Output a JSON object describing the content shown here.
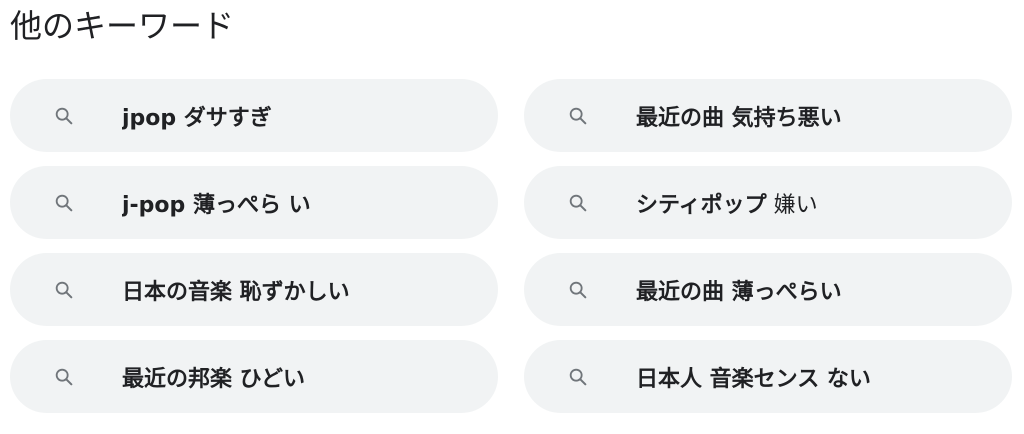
{
  "section": {
    "title": "他のキーワード"
  },
  "keywords": [
    {
      "bold": "jpop ダサすぎ",
      "plain": ""
    },
    {
      "bold": "最近の曲 気持ち悪い",
      "plain": ""
    },
    {
      "bold": "j-pop 薄っぺら い",
      "plain": ""
    },
    {
      "bold": "シティポップ",
      "plain": " 嫌い"
    },
    {
      "bold": "日本の音楽 恥ずかしい",
      "plain": ""
    },
    {
      "bold": "最近の曲 薄っぺらい",
      "plain": ""
    },
    {
      "bold": "最近の邦楽 ひどい",
      "plain": ""
    },
    {
      "bold": "日本人 音楽センス ない",
      "plain": ""
    }
  ],
  "icons": {
    "chip_icon": "search-icon",
    "icon_color": "#70757a"
  },
  "colors": {
    "chip_background": "#f1f3f4",
    "text": "#202124"
  }
}
